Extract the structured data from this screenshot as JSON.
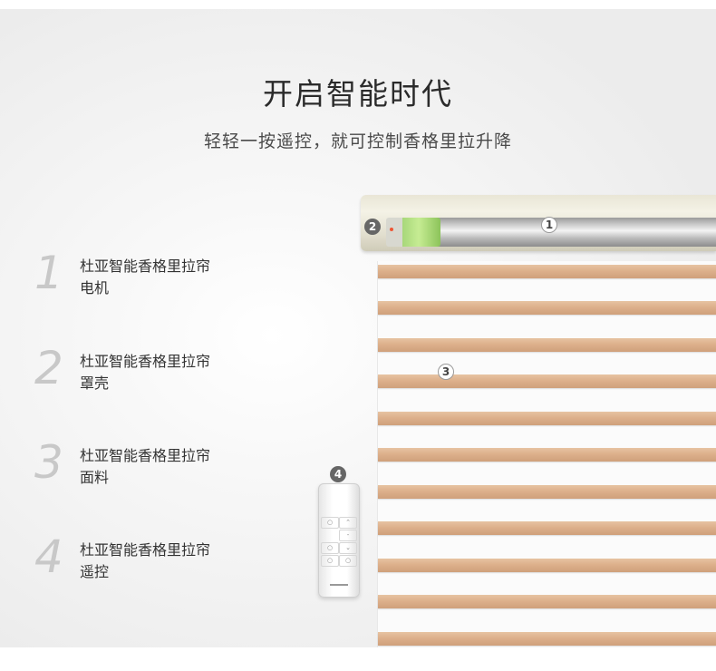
{
  "headline": "开启智能时代",
  "subheadline": "轻轻一按遥控，就可控制香格里拉升降",
  "features": [
    {
      "num": "1",
      "line1": "杜亚智能香格里拉帘",
      "line2": "电机"
    },
    {
      "num": "2",
      "line1": "杜亚智能香格里拉帘",
      "line2": "罩壳"
    },
    {
      "num": "3",
      "line1": "杜亚智能香格里拉帘",
      "line2": "面料"
    },
    {
      "num": "4",
      "line1": "杜亚智能香格里拉帘",
      "line2": "遥控"
    }
  ],
  "callouts": {
    "c1": "1",
    "c2": "2",
    "c3": "3",
    "c4": "4"
  },
  "colors": {
    "slat": "#ddb08b",
    "motor": "#a7d77a",
    "rail": "#e9e6d6"
  }
}
